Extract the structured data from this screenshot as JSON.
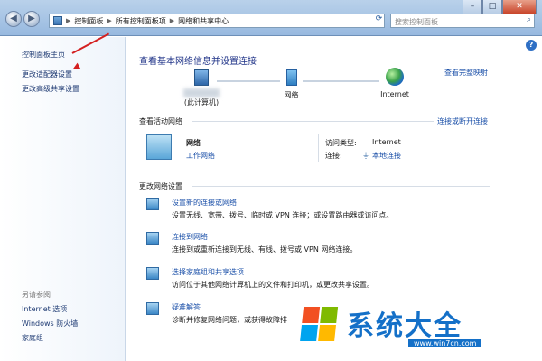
{
  "breadcrumbs": [
    "控制面板",
    "所有控制面板项",
    "网络和共享中心"
  ],
  "search": {
    "placeholder": "搜索控制面板"
  },
  "sidebar": {
    "items": [
      "控制面板主页",
      "更改适配器设置",
      "更改高级共享设置"
    ],
    "see_also_heading": "另请参阅",
    "see_also": [
      "Internet 选项",
      "Windows 防火墙",
      "家庭组"
    ]
  },
  "main": {
    "heading": "查看基本网络信息并设置连接",
    "full_map_link": "查看完整映射",
    "nodes": {
      "computer_label": "(此计算机)",
      "network_label": "网络",
      "internet_label": "Internet"
    },
    "active_heading": "查看活动网络",
    "connect_link": "连接或断开连接",
    "active_network": {
      "name": "网络",
      "type": "工作网络",
      "access_label": "访问类型:",
      "access_value": "Internet",
      "connection_label": "连接:",
      "connection_value": "本地连接"
    },
    "change_heading": "更改网络设置",
    "options": [
      {
        "title": "设置新的连接或网络",
        "desc": "设置无线、宽带、拨号、临时或 VPN 连接；或设置路由器或访问点。"
      },
      {
        "title": "连接到网络",
        "desc": "连接到或重新连接到无线、有线、拨号或 VPN 网络连接。"
      },
      {
        "title": "选择家庭组和共享选项",
        "desc": "访问位于其他网络计算机上的文件和打印机，或更改共享设置。"
      },
      {
        "title": "疑难解答",
        "desc": "诊断并修复网络问题，或获得故障排"
      }
    ]
  },
  "watermark": {
    "text": "系统大全",
    "url": "www.win7cn.com"
  },
  "window": {
    "minimize": "–",
    "maximize": "□",
    "close": "✕"
  },
  "help": "?"
}
